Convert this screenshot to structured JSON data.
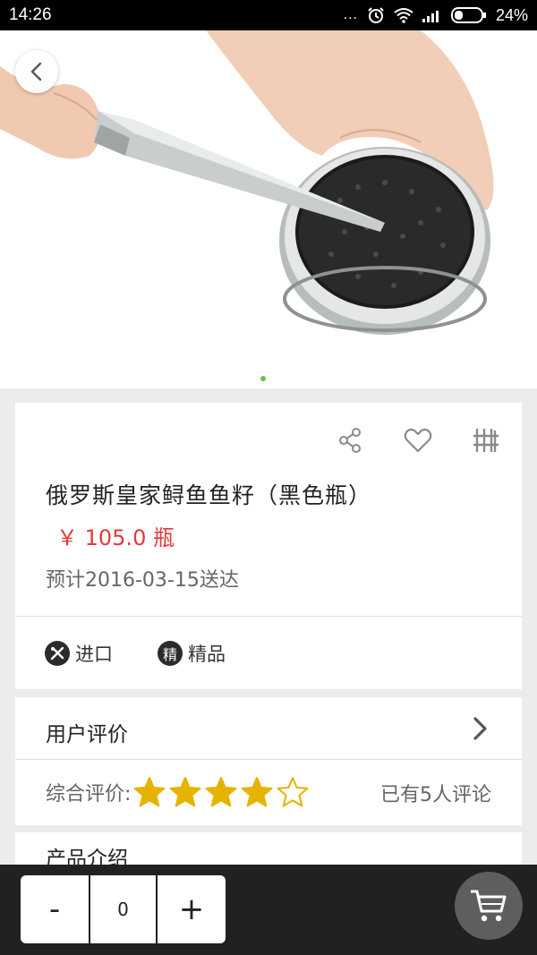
{
  "status_bar": {
    "time": "14:26",
    "more": "...",
    "battery_text": "24%"
  },
  "product": {
    "name": "俄罗斯皇家鲟鱼鱼籽（黑色瓶）",
    "price": "￥ 105.0 瓶",
    "delivery": "预计2016-03-15送达",
    "tags": [
      {
        "icon_text": "",
        "label": "进口"
      },
      {
        "icon_text": "精",
        "label": "精品"
      }
    ]
  },
  "reviews": {
    "title": "用户评价",
    "overall_label": "综合评价:",
    "rating": 4,
    "max_rating": 5,
    "count_text": "已有5人评论"
  },
  "intro": {
    "title": "产品介绍"
  },
  "cart": {
    "minus": "-",
    "quantity": "0",
    "plus": "+"
  },
  "colors": {
    "price": "#e5383b",
    "star": "#e6b400",
    "pager_active": "#6cc04a"
  }
}
